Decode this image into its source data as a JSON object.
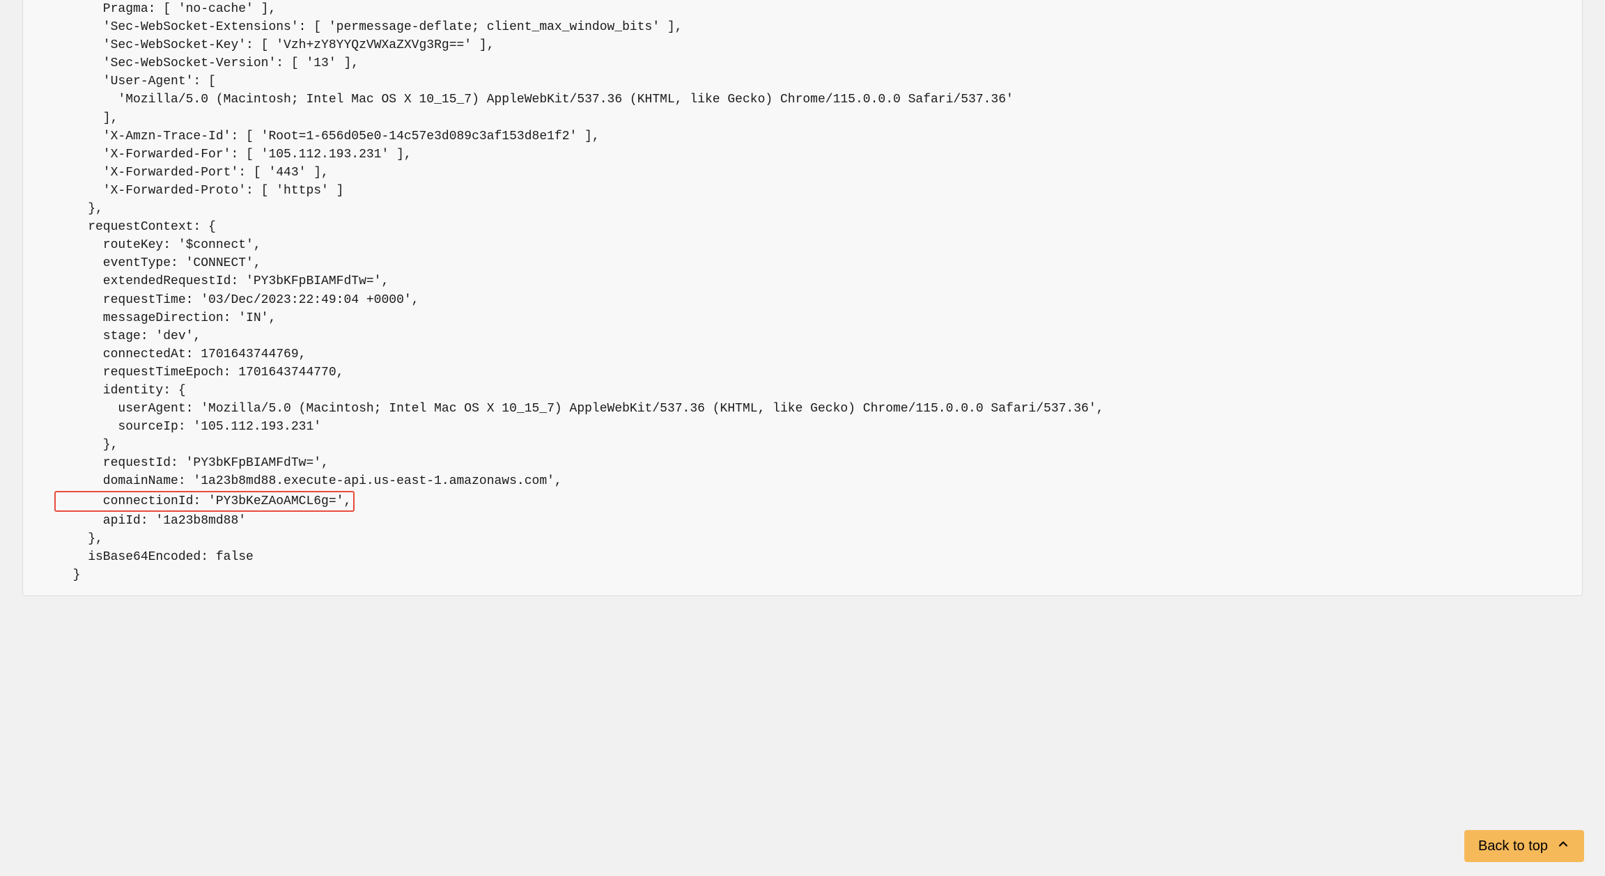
{
  "code": {
    "line1": "      Pragma: [ 'no-cache' ],",
    "line2": "      'Sec-WebSocket-Extensions': [ 'permessage-deflate; client_max_window_bits' ],",
    "line3": "      'Sec-WebSocket-Key': [ 'Vzh+zY8YYQzVWXaZXVg3Rg==' ],",
    "line4": "      'Sec-WebSocket-Version': [ '13' ],",
    "line5": "      'User-Agent': [",
    "line6": "        'Mozilla/5.0 (Macintosh; Intel Mac OS X 10_15_7) AppleWebKit/537.36 (KHTML, like Gecko) Chrome/115.0.0.0 Safari/537.36'",
    "line7": "      ],",
    "line8": "      'X-Amzn-Trace-Id': [ 'Root=1-656d05e0-14c57e3d089c3af153d8e1f2' ],",
    "line9": "      'X-Forwarded-For': [ '105.112.193.231' ],",
    "line10": "      'X-Forwarded-Port': [ '443' ],",
    "line11": "      'X-Forwarded-Proto': [ 'https' ]",
    "line12": "    },",
    "line13": "    requestContext: {",
    "line14": "      routeKey: '$connect',",
    "line15": "      eventType: 'CONNECT',",
    "line16": "      extendedRequestId: 'PY3bKFpBIAMFdTw=',",
    "line17": "      requestTime: '03/Dec/2023:22:49:04 +0000',",
    "line18": "      messageDirection: 'IN',",
    "line19": "      stage: 'dev',",
    "line20": "      connectedAt: 1701643744769,",
    "line21": "      requestTimeEpoch: 1701643744770,",
    "line22": "      identity: {",
    "line23": "        userAgent: 'Mozilla/5.0 (Macintosh; Intel Mac OS X 10_15_7) AppleWebKit/537.36 (KHTML, like Gecko) Chrome/115.0.0.0 Safari/537.36',",
    "line24": "        sourceIp: '105.112.193.231'",
    "line25": "      },",
    "line26": "      requestId: 'PY3bKFpBIAMFdTw=',",
    "line27": "      domainName: '1a23b8md88.execute-api.us-east-1.amazonaws.com',",
    "line28_highlighted": "      connectionId: 'PY3bKeZAoAMCL6g=',",
    "line29": "      apiId: '1a23b8md88'",
    "line30": "    },",
    "line31": "    isBase64Encoded: false",
    "line32": "  }"
  },
  "ui": {
    "back_to_top_label": "Back to top"
  }
}
